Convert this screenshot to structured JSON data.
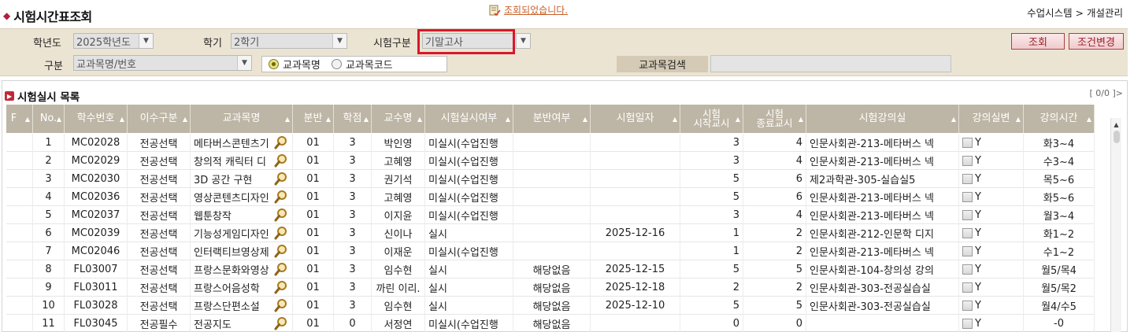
{
  "header": {
    "title": "시험시간표조회",
    "notice": "조회되었습니다.",
    "breadcrumb": "수업시스템 > 개설관리"
  },
  "search": {
    "year_label": "학년도",
    "year_value": "2025학년도",
    "semester_label": "학기",
    "semester_value": "2학기",
    "exam_type_label": "시험구분",
    "exam_type_value": "기말고사",
    "type_label": "구분",
    "type_value": "교과목명/번호",
    "radio_name": "교과목명",
    "radio_code": "교과목코드",
    "course_search_label": "교과목검색",
    "course_search_value": "",
    "search_button": "조회",
    "reset_button": "조건변경"
  },
  "list": {
    "title": "시험실시 목록",
    "pager": "[ 0/0 ]>"
  },
  "columns": [
    {
      "label": "F"
    },
    {
      "label": "No."
    },
    {
      "label": "학수번호"
    },
    {
      "label": "이수구분"
    },
    {
      "label": "교과목명"
    },
    {
      "label": "분반"
    },
    {
      "label": "학점"
    },
    {
      "label": "교수명"
    },
    {
      "label": "시험실시여부"
    },
    {
      "label": "분반여부"
    },
    {
      "label": "시험일자"
    },
    {
      "label": "시험\n시작교시"
    },
    {
      "label": "시험\n종료교시"
    },
    {
      "label": "시험강의실"
    },
    {
      "label": "강의실변"
    },
    {
      "label": "강의시간"
    }
  ],
  "rows": [
    {
      "no": "1",
      "code": "MC02028",
      "category": "전공선택",
      "course": "메타버스콘텐츠기",
      "section": "01",
      "credit": "3",
      "prof": "박인영",
      "exam": "미실시(수업진행",
      "split": "",
      "date": "",
      "start": "3",
      "end": "4",
      "room": "인문사회관-213-메타버스 넥",
      "room_chg": "Y",
      "time": "화3~4"
    },
    {
      "no": "2",
      "code": "MC02029",
      "category": "전공선택",
      "course": "창의적 캐릭터 디",
      "section": "01",
      "credit": "3",
      "prof": "고혜영",
      "exam": "미실시(수업진행",
      "split": "",
      "date": "",
      "start": "3",
      "end": "4",
      "room": "인문사회관-213-메타버스 넥",
      "room_chg": "Y",
      "time": "수3~4"
    },
    {
      "no": "3",
      "code": "MC02030",
      "category": "전공선택",
      "course": "3D 공간 구현",
      "section": "01",
      "credit": "3",
      "prof": "권기석",
      "exam": "미실시(수업진행",
      "split": "",
      "date": "",
      "start": "5",
      "end": "6",
      "room": "제2과학관-305-실습실5",
      "room_chg": "Y",
      "time": "목5~6"
    },
    {
      "no": "4",
      "code": "MC02036",
      "category": "전공선택",
      "course": "영상콘텐츠디자인",
      "section": "01",
      "credit": "3",
      "prof": "고혜영",
      "exam": "미실시(수업진행",
      "split": "",
      "date": "",
      "start": "5",
      "end": "6",
      "room": "인문사회관-213-메타버스 넥",
      "room_chg": "Y",
      "time": "화5~6"
    },
    {
      "no": "5",
      "code": "MC02037",
      "category": "전공선택",
      "course": "웹툰창작",
      "section": "01",
      "credit": "3",
      "prof": "이지윤",
      "exam": "미실시(수업진행",
      "split": "",
      "date": "",
      "start": "3",
      "end": "4",
      "room": "인문사회관-213-메타버스 넥",
      "room_chg": "Y",
      "time": "월3~4"
    },
    {
      "no": "6",
      "code": "MC02039",
      "category": "전공선택",
      "course": "기능성게임디자인",
      "section": "01",
      "credit": "3",
      "prof": "신이나",
      "exam": "실시",
      "split": "",
      "date": "2025-12-16",
      "start": "1",
      "end": "2",
      "room": "인문사회관-212-인문학 디지",
      "room_chg": "Y",
      "time": "화1~2"
    },
    {
      "no": "7",
      "code": "MC02046",
      "category": "전공선택",
      "course": "인터랙티브영상제",
      "section": "01",
      "credit": "3",
      "prof": "이재운",
      "exam": "미실시(수업진행",
      "split": "",
      "date": "",
      "start": "1",
      "end": "2",
      "room": "인문사회관-213-메타버스 넥",
      "room_chg": "Y",
      "time": "수1~2"
    },
    {
      "no": "8",
      "code": "FL03007",
      "category": "전공선택",
      "course": "프랑스문화와영상",
      "section": "01",
      "credit": "3",
      "prof": "임수현",
      "exam": "실시",
      "split": "해당없음",
      "date": "2025-12-15",
      "start": "5",
      "end": "5",
      "room": "인문사회관-104-창의성 강의",
      "room_chg": "Y",
      "time": "월5/목4"
    },
    {
      "no": "9",
      "code": "FL03011",
      "category": "전공선택",
      "course": "프랑스어음성학",
      "section": "01",
      "credit": "3",
      "prof": "까린 이리.",
      "exam": "실시",
      "split": "해당없음",
      "date": "2025-12-18",
      "start": "2",
      "end": "2",
      "room": "인문사회관-303-전공실습실",
      "room_chg": "Y",
      "time": "월5/목2"
    },
    {
      "no": "10",
      "code": "FL03028",
      "category": "전공선택",
      "course": "프랑스단편소설",
      "section": "01",
      "credit": "3",
      "prof": "임수현",
      "exam": "실시",
      "split": "해당없음",
      "date": "2025-12-10",
      "start": "5",
      "end": "5",
      "room": "인문사회관-303-전공실습실",
      "room_chg": "Y",
      "time": "월4/수5"
    },
    {
      "no": "11",
      "code": "FL03045",
      "category": "전공필수",
      "course": "전공지도",
      "section": "01",
      "credit": "0",
      "prof": "서정연",
      "exam": "미실시(수업진행",
      "split": "해당없음",
      "date": "",
      "start": "0",
      "end": "0",
      "room": "",
      "room_chg": "Y",
      "time": "-0"
    }
  ],
  "icons": {
    "title": "diamond-icon",
    "notice": "memo-check-icon",
    "list_marker": "arrow-marker-icon",
    "course_lookup": "magnifier-icon",
    "sort": "sort-arrow-icon"
  },
  "colors": {
    "accent": "#b0203a",
    "header_bg": "#bdb5a5",
    "panel_bg": "#ece4d3",
    "highlight": "#d8182b"
  }
}
